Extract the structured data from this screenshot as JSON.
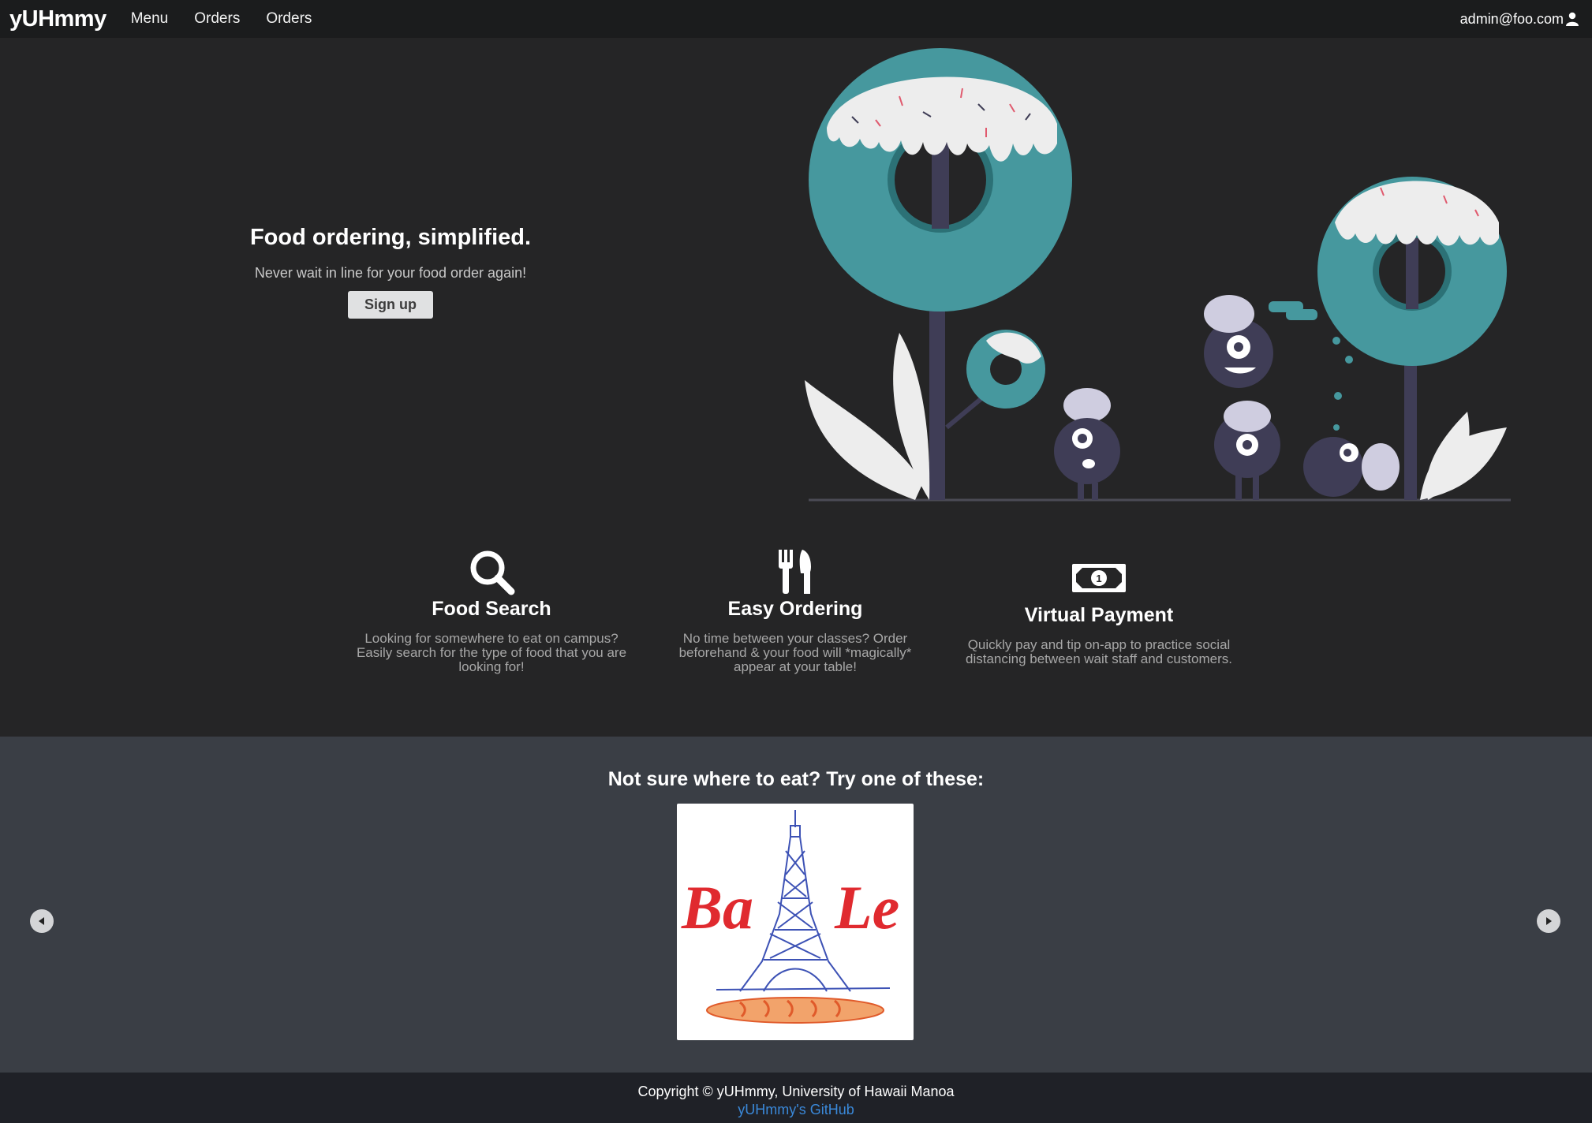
{
  "navbar": {
    "brand": "yUHmmy",
    "links": [
      "Menu",
      "Orders",
      "Orders"
    ],
    "user": "admin@foo.com"
  },
  "hero": {
    "title": "Food ordering, simplified.",
    "subtitle": "Never wait in line for your food order again!",
    "button": "Sign up"
  },
  "features": [
    {
      "icon": "search-icon",
      "title": "Food Search",
      "lines": [
        "Looking for somewhere to eat on campus?",
        "Easily search for the type of food that you are",
        "looking for!"
      ]
    },
    {
      "icon": "utensils-icon",
      "title": "Easy Ordering",
      "lines": [
        "No time between your classes? Order",
        "beforehand & your food will *magically*",
        "appear at your table!"
      ]
    },
    {
      "icon": "money-bill-icon",
      "title": "Virtual Payment",
      "lines": [
        "Quickly pay and tip on-app to practice social",
        "distancing between wait staff and customers."
      ]
    }
  ],
  "carousel": {
    "title": "Not sure where to eat? Try one of these:",
    "logo_text_left": "Ba",
    "logo_text_right": "Le"
  },
  "footer": {
    "copyright": "Copyright © yUHmmy, University of Hawaii Manoa",
    "github_link": "yUHmmy's GitHub"
  },
  "colors": {
    "background": "#252526",
    "navbar": "#1b1c1d",
    "carousel_bg": "#3a3e45",
    "footer": "#1f2127",
    "donut_teal": "#46989e",
    "link": "#3a88d8"
  }
}
